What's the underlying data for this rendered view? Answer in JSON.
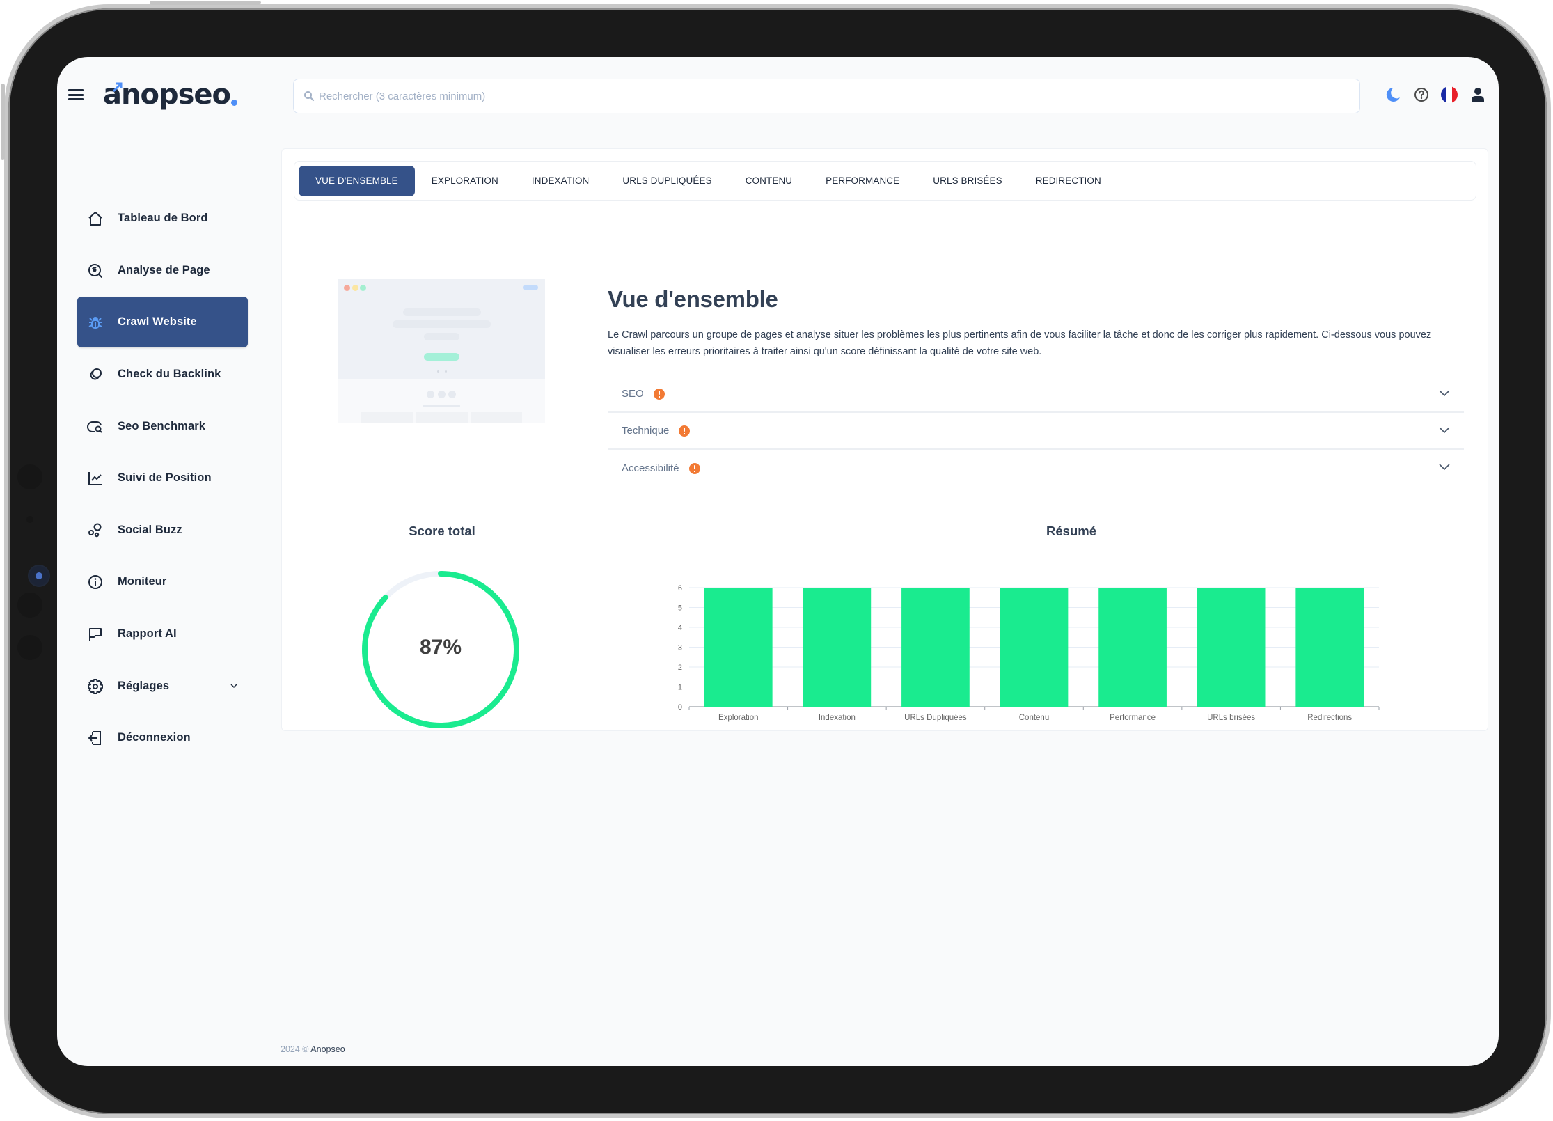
{
  "app": {
    "brand": "anopseo",
    "brand_mark_color": "#4f8ff7"
  },
  "header": {
    "search_placeholder": "Rechercher (3 caractères minimum)",
    "icons": [
      "menu-icon",
      "moon-icon",
      "help-icon",
      "flag-fr-icon",
      "user-icon"
    ]
  },
  "sidebar": {
    "items": [
      {
        "label": "Tableau de Bord",
        "icon": "home-icon",
        "active": false
      },
      {
        "label": "Analyse de Page",
        "icon": "page-analysis-icon",
        "active": false
      },
      {
        "label": "Crawl Website",
        "icon": "bug-icon",
        "active": true
      },
      {
        "label": "Check du Backlink",
        "icon": "link-icon",
        "active": false
      },
      {
        "label": "Seo Benchmark",
        "icon": "chat-search-icon",
        "active": false
      },
      {
        "label": "Suivi de Position",
        "icon": "line-chart-icon",
        "active": false
      },
      {
        "label": "Social Buzz",
        "icon": "bubbles-icon",
        "active": false
      },
      {
        "label": "Moniteur",
        "icon": "info-icon",
        "active": false
      },
      {
        "label": "Rapport AI",
        "icon": "flag-icon",
        "active": false
      },
      {
        "label": "Réglages",
        "icon": "gear-icon",
        "active": false,
        "has_submenu": true
      },
      {
        "label": "Déconnexion",
        "icon": "logout-icon",
        "active": false
      }
    ]
  },
  "tabs": [
    {
      "label": "VUE D'ENSEMBLE",
      "active": true
    },
    {
      "label": "EXPLORATION",
      "active": false
    },
    {
      "label": "INDEXATION",
      "active": false
    },
    {
      "label": "URLS DUPLIQUÉES",
      "active": false
    },
    {
      "label": "CONTENU",
      "active": false
    },
    {
      "label": "PERFORMANCE",
      "active": false
    },
    {
      "label": "URLS BRISÉES",
      "active": false
    },
    {
      "label": "REDIRECTION",
      "active": false
    }
  ],
  "overview": {
    "title": "Vue d'ensemble",
    "description": "Le Crawl parcours un groupe de pages et analyse situer les problèmes les plus pertinents afin de vous faciliter la tâche et donc de les corriger plus rapidement. Ci-dessous vous pouvez visualiser les erreurs prioritaires à traiter ainsi qu'un score définissant la qualité de votre site web.",
    "accordion": [
      {
        "label": "SEO",
        "status": "warning"
      },
      {
        "label": "Technique",
        "status": "warning"
      },
      {
        "label": "Accessibilité",
        "status": "warning"
      }
    ]
  },
  "score": {
    "title": "Score total",
    "value": 87,
    "display": "87%",
    "color": "#1aeb8f",
    "track_color": "#eef2f8"
  },
  "summary": {
    "title": "Résumé"
  },
  "chart_data": {
    "type": "bar",
    "title": "Résumé",
    "categories": [
      "Exploration",
      "Indexation",
      "URLs Dupliquées",
      "Contenu",
      "Performance",
      "URLs brisées",
      "Redirections"
    ],
    "values": [
      6,
      6,
      6,
      6,
      6,
      6,
      6
    ],
    "xlabel": "",
    "ylabel": "",
    "ylim": [
      0,
      6
    ],
    "yticks": [
      0,
      1,
      2,
      3,
      4,
      5,
      6
    ],
    "grid": true,
    "legend": "none",
    "bar_color": "#1aeb8f"
  },
  "footer": {
    "year": "2024 ©",
    "brand": "Anopseo"
  }
}
